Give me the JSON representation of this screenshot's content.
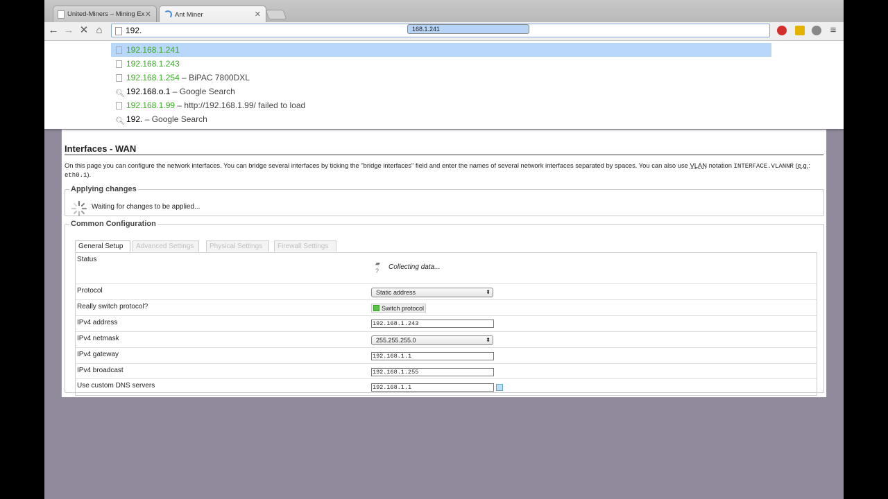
{
  "browser": {
    "tabs": [
      {
        "title": "United-Miners – Mining Ex",
        "active": false
      },
      {
        "title": "Ant Miner",
        "active": true
      }
    ],
    "url_plain": "192.",
    "url_selected": "168.1.241",
    "suggestions": [
      {
        "green": "192.168.1.241",
        "rest": "",
        "icon": "page",
        "highlighted": true
      },
      {
        "green": "192.168.1.243",
        "rest": "",
        "icon": "page",
        "highlighted": false
      },
      {
        "green": "192.168.1.254",
        "rest": " – BiPAC 7800DXL",
        "icon": "page",
        "highlighted": false
      },
      {
        "bold": "192.168.o.1",
        "rest": " – Google Search",
        "icon": "search",
        "highlighted": false
      },
      {
        "green": "192.168.1.99",
        "rest": " – http://192.168.1.99/ failed to load",
        "icon": "page",
        "highlighted": false
      },
      {
        "bold": "192.",
        "rest": " – Google Search",
        "icon": "search",
        "highlighted": false
      }
    ]
  },
  "page": {
    "title": "Interfaces - WAN",
    "desc_1": "On this page you can configure the network interfaces. You can bridge several interfaces by ticking the \"bridge interfaces\" field and enter the names of several network interfaces separated by spaces. You can also use ",
    "desc_vlan": "VLAN",
    "desc_2": " notation ",
    "desc_code": "INTERFACE.VLANNR",
    "desc_3": " (",
    "desc_eg": "e.g.",
    "desc_4": ": ",
    "desc_code2": "eth0.1",
    "desc_5": ").",
    "applying": {
      "legend": "Applying changes",
      "message": "Waiting for changes to be applied..."
    },
    "common": {
      "legend": "Common Configuration",
      "tabs": [
        "General Setup",
        "Advanced Settings",
        "Physical Settings",
        "Firewall Settings"
      ],
      "status_label": "Status",
      "status_value": "Collecting data...",
      "protocol_label": "Protocol",
      "protocol_value": "Static address",
      "switch_label": "Really switch protocol?",
      "switch_button": "Switch protocol",
      "ipv4_address_label": "IPv4 address",
      "ipv4_address": "192.168.1.243",
      "netmask_label": "IPv4 netmask",
      "netmask": "255.255.255.0",
      "gateway_label": "IPv4 gateway",
      "gateway": "192.168.1.1",
      "broadcast_label": "IPv4 broadcast",
      "broadcast": "192.168.1.255",
      "dns_label": "Use custom DNS servers",
      "dns": "192.168.1.1"
    }
  },
  "colors": {
    "page_background": "#918a9d",
    "suggestion_green": "#3cab28",
    "highlight": "#b8d7fa"
  }
}
